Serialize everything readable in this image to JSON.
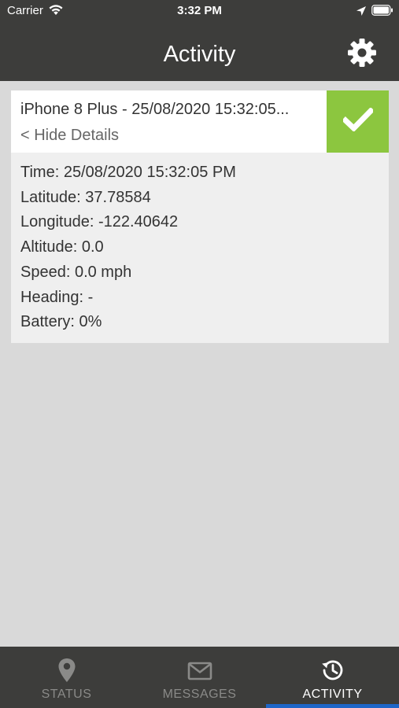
{
  "status_bar": {
    "carrier": "Carrier",
    "time": "3:32 PM",
    "icons": [
      "wifi-icon",
      "location-arrow-icon",
      "battery-icon"
    ]
  },
  "nav": {
    "title": "Activity",
    "settings_icon": "gear-icon"
  },
  "activity_card": {
    "title": "iPhone 8 Plus - 25/08/2020 15:32:05...",
    "hide_details_label": "< Hide Details",
    "status_icon": "checkmark-icon",
    "status_color": "#8cc63f",
    "details": [
      "Time: 25/08/2020 15:32:05 PM",
      "Latitude: 37.78584",
      "Longitude: -122.40642",
      "Altitude: 0.0",
      "Speed: 0.0 mph",
      "Heading: -",
      "Battery: 0%"
    ]
  },
  "tabs": [
    {
      "label": "STATUS",
      "icon": "map-pin-icon",
      "active": false
    },
    {
      "label": "MESSAGES",
      "icon": "envelope-icon",
      "active": false
    },
    {
      "label": "ACTIVITY",
      "icon": "history-icon",
      "active": true
    }
  ],
  "colors": {
    "bar_background": "#3d3d3b",
    "page_background": "#d9d9d9",
    "active_tab_indicator": "#1e66c8",
    "success_green": "#8cc63f"
  }
}
